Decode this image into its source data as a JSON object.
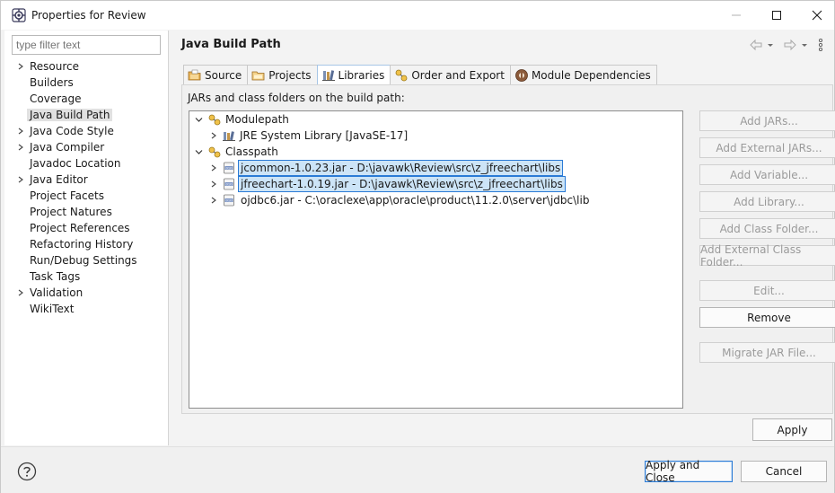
{
  "window": {
    "title": "Properties for Review",
    "minimize_icon": "minimize-icon",
    "maximize_icon": "maximize-icon",
    "close_icon": "close-icon"
  },
  "sidebar": {
    "filter_placeholder": "type filter text",
    "items": [
      {
        "label": "Resource",
        "expandable": true
      },
      {
        "label": "Builders",
        "expandable": false
      },
      {
        "label": "Coverage",
        "expandable": false
      },
      {
        "label": "Java Build Path",
        "expandable": false,
        "selected": true
      },
      {
        "label": "Java Code Style",
        "expandable": true
      },
      {
        "label": "Java Compiler",
        "expandable": true
      },
      {
        "label": "Javadoc Location",
        "expandable": false
      },
      {
        "label": "Java Editor",
        "expandable": true
      },
      {
        "label": "Project Facets",
        "expandable": false
      },
      {
        "label": "Project Natures",
        "expandable": false
      },
      {
        "label": "Project References",
        "expandable": false
      },
      {
        "label": "Refactoring History",
        "expandable": false
      },
      {
        "label": "Run/Debug Settings",
        "expandable": false
      },
      {
        "label": "Task Tags",
        "expandable": false
      },
      {
        "label": "Validation",
        "expandable": true
      },
      {
        "label": "WikiText",
        "expandable": false
      }
    ]
  },
  "page": {
    "title": "Java Build Path",
    "tabs": [
      {
        "label": "Source",
        "icon": "source-folder-icon"
      },
      {
        "label": "Projects",
        "icon": "projects-icon"
      },
      {
        "label": "Libraries",
        "icon": "libraries-icon",
        "active": true
      },
      {
        "label": "Order and Export",
        "icon": "order-export-icon"
      },
      {
        "label": "Module Dependencies",
        "icon": "module-dependencies-icon"
      }
    ],
    "libraries_label": "JARs and class folders on the build path:",
    "tree": {
      "modulepath": "Modulepath",
      "jre": "JRE System Library [JavaSE-17]",
      "classpath": "Classpath",
      "jars": [
        "jcommon-1.0.23.jar - D:\\javawk\\Review\\src\\z_jfreechart\\libs",
        "jfreechart-1.0.19.jar - D:\\javawk\\Review\\src\\z_jfreechart\\libs",
        "ojdbc6.jar - C:\\oraclexe\\app\\oracle\\product\\11.2.0\\server\\jdbc\\lib"
      ]
    },
    "buttons": {
      "add_jars": "Add JARs...",
      "add_external_jars": "Add External JARs...",
      "add_variable": "Add Variable...",
      "add_library": "Add Library...",
      "add_class_folder": "Add Class Folder...",
      "add_external_class_folder": "Add External Class Folder...",
      "edit": "Edit...",
      "remove": "Remove",
      "migrate_jar": "Migrate JAR File..."
    },
    "apply": "Apply"
  },
  "footer": {
    "apply_and_close": "Apply and Close",
    "cancel": "Cancel"
  },
  "colors": {
    "selection_bg": "#cce4f7",
    "selection_border": "#2b7bd6"
  }
}
